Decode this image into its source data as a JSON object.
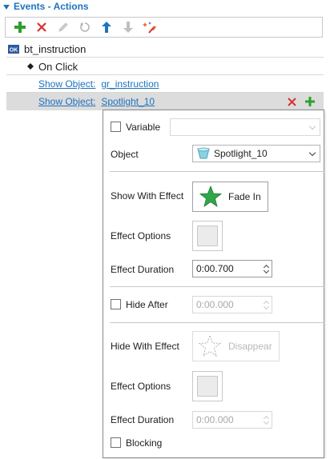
{
  "panel": {
    "title": "Events - Actions"
  },
  "colors": {
    "accent": "#1e73be",
    "add_green": "#2e9e2e",
    "delete_red": "#d83030"
  },
  "toolbar": {
    "buttons": [
      {
        "icon": "plus-icon",
        "label": "Add"
      },
      {
        "icon": "close-icon",
        "label": "Delete"
      },
      {
        "icon": "pencil-icon",
        "label": "Edit"
      },
      {
        "icon": "undo-icon",
        "label": "Undo"
      },
      {
        "icon": "arrow-up-icon",
        "label": "Move Up"
      },
      {
        "icon": "arrow-down-icon",
        "label": "Move Down"
      },
      {
        "icon": "magic-wand-icon",
        "label": "Effects"
      }
    ]
  },
  "tree": {
    "object": {
      "icon": "ok-button-icon",
      "name": "bt_instruction"
    },
    "event": {
      "label": "On Click"
    },
    "actions": [
      {
        "action": "Show Object:",
        "target": "gr_instruction"
      },
      {
        "action": "Show Object:",
        "target": "Spotlight_10"
      }
    ]
  },
  "popup": {
    "variable": {
      "label": "Variable",
      "checked": false,
      "value": ""
    },
    "object": {
      "label": "Object",
      "value": "Spotlight_10",
      "icon": "spotlight-icon"
    },
    "show_effect": {
      "label": "Show With Effect",
      "value": "Fade In",
      "icon": "green-star-icon"
    },
    "show_effect_options": {
      "label": "Effect Options"
    },
    "show_effect_duration": {
      "label": "Effect Duration",
      "value": "0:00.700"
    },
    "hide_after": {
      "label": "Hide After",
      "checked": false,
      "value": "0:00.000"
    },
    "hide_effect": {
      "label": "Hide With Effect",
      "value": "Disappear",
      "icon": "outline-star-icon"
    },
    "hide_effect_options": {
      "label": "Effect Options"
    },
    "hide_effect_duration": {
      "label": "Effect Duration",
      "value": "0:00.000"
    },
    "blocking": {
      "label": "Blocking",
      "checked": false
    }
  }
}
